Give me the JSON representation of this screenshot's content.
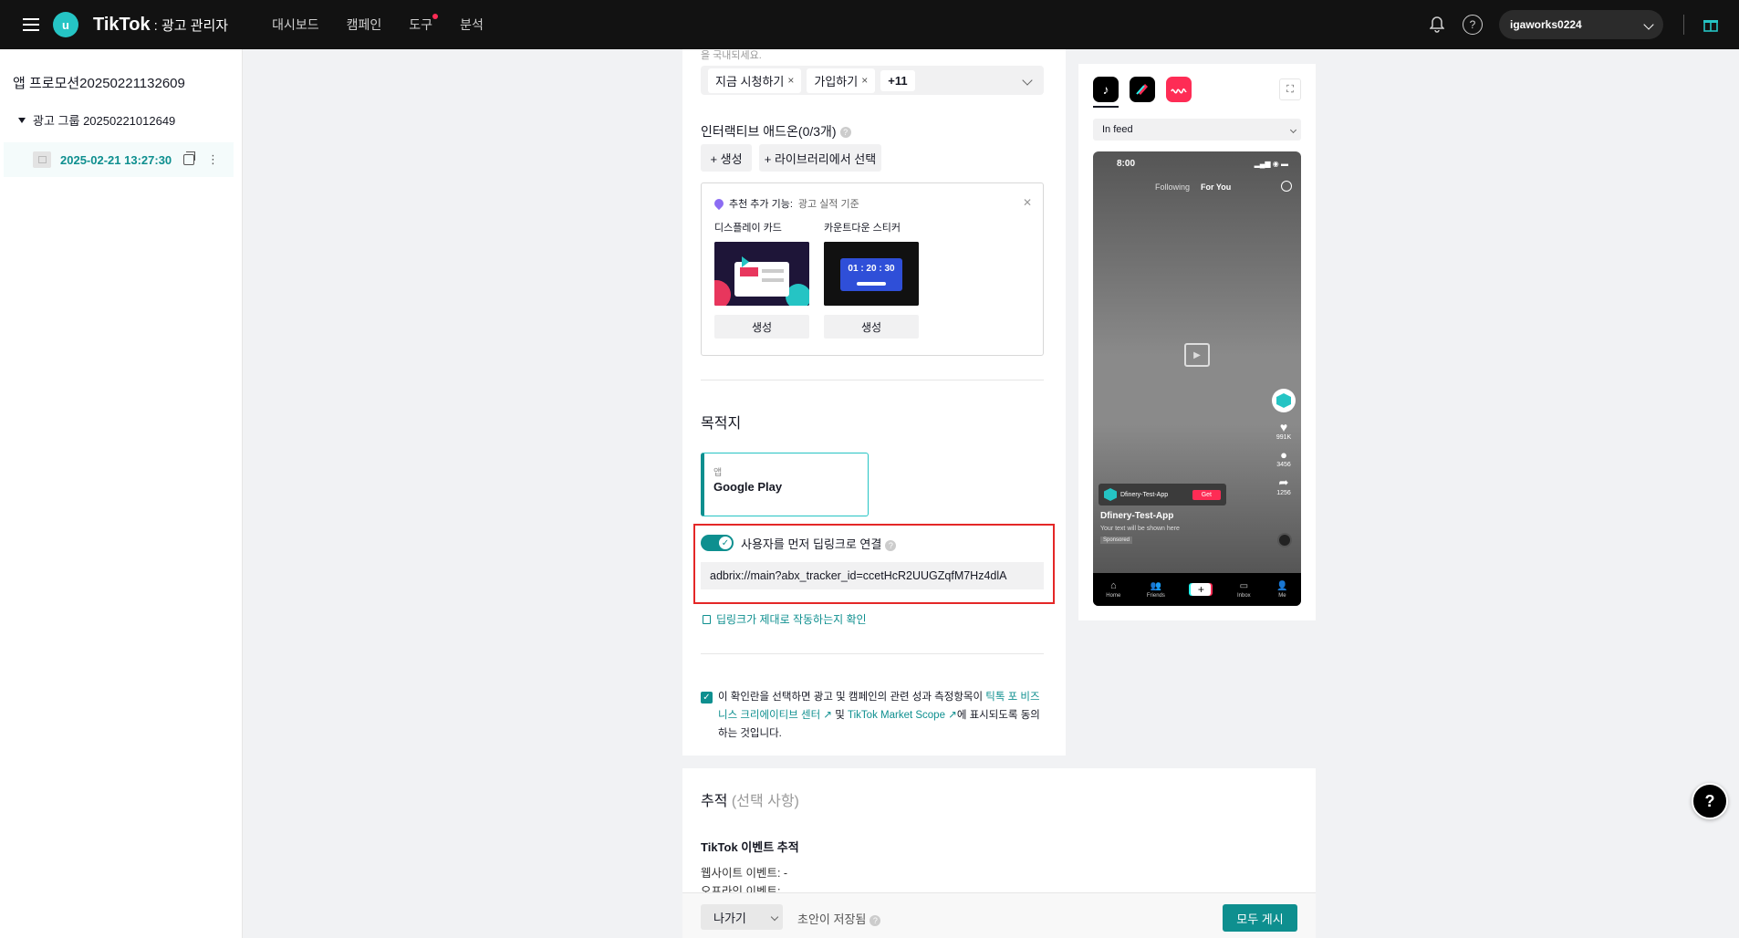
{
  "header": {
    "user_initial": "u",
    "brand": "TikTok",
    "brand_sub": ": 광고 관리자",
    "nav": [
      "대시보드",
      "캠페인",
      "도구",
      "분석"
    ],
    "account": "igaworks0224"
  },
  "sidebar": {
    "campaign": "앱 프로모션20250221132609",
    "ad_group": "광고 그룹 20250221012649",
    "ad": "2025-02-21 13:27:30"
  },
  "cta": {
    "faded_text": "을 국내되세요.",
    "tags": [
      "지금 시청하기",
      "가입하기"
    ],
    "more": "+11"
  },
  "interactive": {
    "label": "인터랙티브 애드온(0/3개)",
    "create": "+ 생성",
    "library": "+ 라이브러리에서 선택",
    "rec_title": "추천 추가 기능:",
    "rec_sub": "광고 실적 기준",
    "card1_label": "디스플레이 카드",
    "card2_label": "카운트다운 스티커",
    "countdown": "01 : 20 : 30",
    "card_create": "생성"
  },
  "destination": {
    "title": "목적지",
    "type": "앱",
    "store": "Google Play",
    "deeplink_label": "사용자를 먼저 딥링크로 연결",
    "deeplink_value": "adbrix://main?abx_tracker_id=ccetHcR2UUGZqfM7Hz4dlA",
    "check_link": "딥링크가 제대로 작동하는지 확인"
  },
  "consent": {
    "part1": "이 확인란을 선택하면 광고 및 캠페인의 관련 성과 측정항목이 ",
    "link1": "틱톡 포 비즈니스 크리에이티브 센터",
    "part2": " 및 ",
    "link2": "TikTok Market Scope",
    "part3": "에 표시되도록 동의하는 것입니다."
  },
  "preview": {
    "placement": "In feed",
    "time": "8:00",
    "tab_following": "Following",
    "tab_foryou": "For You",
    "likes": "991K",
    "comments": "3456",
    "shares": "1256",
    "app_name_short": "Dfinery-Test-App",
    "get": "Get",
    "app_name": "Dfinery-Test-App",
    "text": "Your text will be shown here",
    "sponsored": "Sponsored",
    "nav": [
      "Home",
      "Friends",
      "",
      "Inbox",
      "Me"
    ]
  },
  "tracking": {
    "title": "추적",
    "optional": "(선택 사항)",
    "sub": "TikTok 이벤트 추적",
    "web": "웹사이트 이벤트: -",
    "offline": "오프라인 이벤트:"
  },
  "footer": {
    "exit": "나가기",
    "saved": "초안이 저장됨",
    "publish": "모두 게시"
  },
  "colors": {
    "accent": "#0e8f8f",
    "highlight": "#e42727"
  }
}
